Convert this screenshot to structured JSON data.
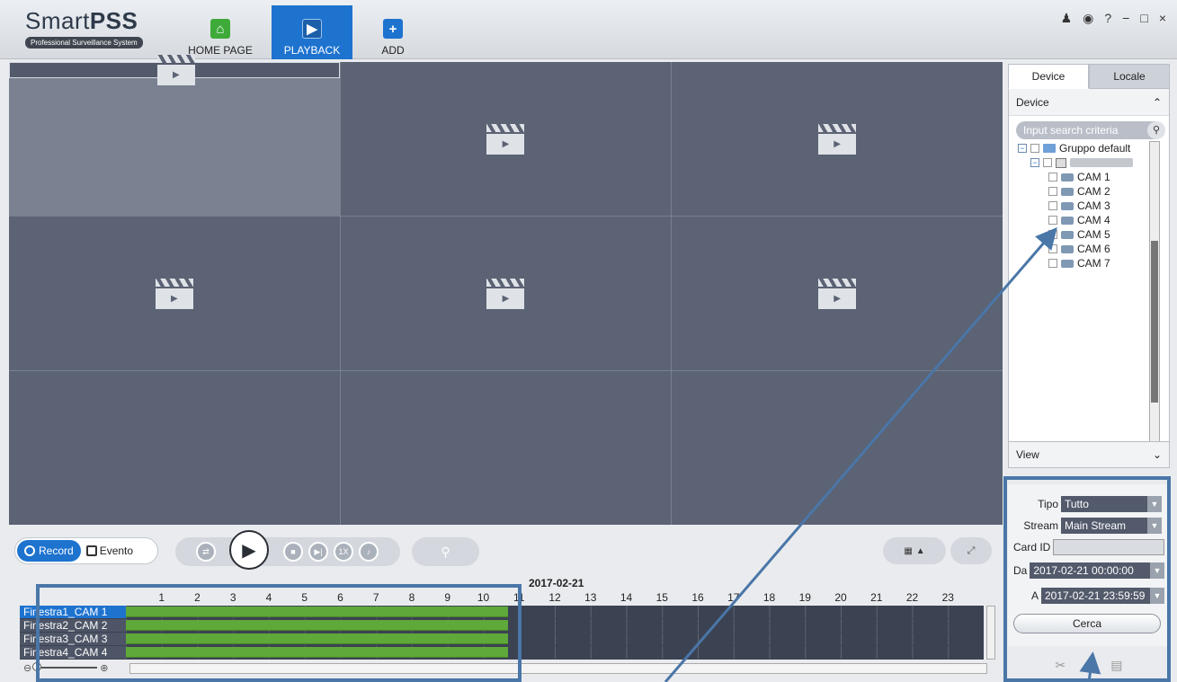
{
  "app": {
    "title_light": "Smart",
    "title_bold": "PSS",
    "subtitle": "Professional Surveillance System"
  },
  "nav": {
    "home": "HOME PAGE",
    "playback": "PLAYBACK",
    "add": "ADD"
  },
  "window_controls": [
    "person-icon",
    "lock-icon",
    "help-icon",
    "minimize-icon",
    "maximize-icon",
    "close-icon"
  ],
  "window_glyphs": {
    "help": "?",
    "minimize": "−",
    "maximize": "□",
    "close": "×"
  },
  "controls": {
    "record": "Record",
    "evento": "Evento",
    "speed": "1X"
  },
  "timeline": {
    "date": "2017-02-21",
    "hours": [
      "1",
      "2",
      "3",
      "4",
      "5",
      "6",
      "7",
      "8",
      "9",
      "10",
      "11",
      "12",
      "13",
      "14",
      "15",
      "16",
      "17",
      "18",
      "19",
      "20",
      "21",
      "22",
      "23"
    ],
    "channels": [
      {
        "label": "Finestra1_CAM 1",
        "recorded_until_hour": 10.7
      },
      {
        "label": "Finestra2_CAM 2",
        "recorded_until_hour": 10.7
      },
      {
        "label": "Finestra3_CAM 3",
        "recorded_until_hour": 10.7
      },
      {
        "label": "Finestra4_CAM 4",
        "recorded_until_hour": 10.7
      }
    ]
  },
  "panel": {
    "tabs": [
      "Device",
      "Locale"
    ],
    "device_header": "Device",
    "search_placeholder": "Input search criteria",
    "group": "Gruppo default",
    "cameras": [
      "CAM 1",
      "CAM 2",
      "CAM 3",
      "CAM 4",
      "CAM 5",
      "CAM 6",
      "CAM 7"
    ],
    "view_label": "View"
  },
  "filters": {
    "tipo_label": "Tipo",
    "tipo_value": "Tutto",
    "stream_label": "Stream",
    "stream_value": "Main Stream",
    "card_label": "Card ID",
    "card_value": "",
    "da_label": "Da",
    "da_value": "2017-02-21 00:00:00",
    "a_label": "A",
    "a_value": "2017-02-21 23:59:59",
    "search_button": "Cerca"
  },
  "colors": {
    "accent": "#1e73cf",
    "video_bg": "#5b6374",
    "recorded": "#5fa83a",
    "annotation": "#4a76a8"
  }
}
